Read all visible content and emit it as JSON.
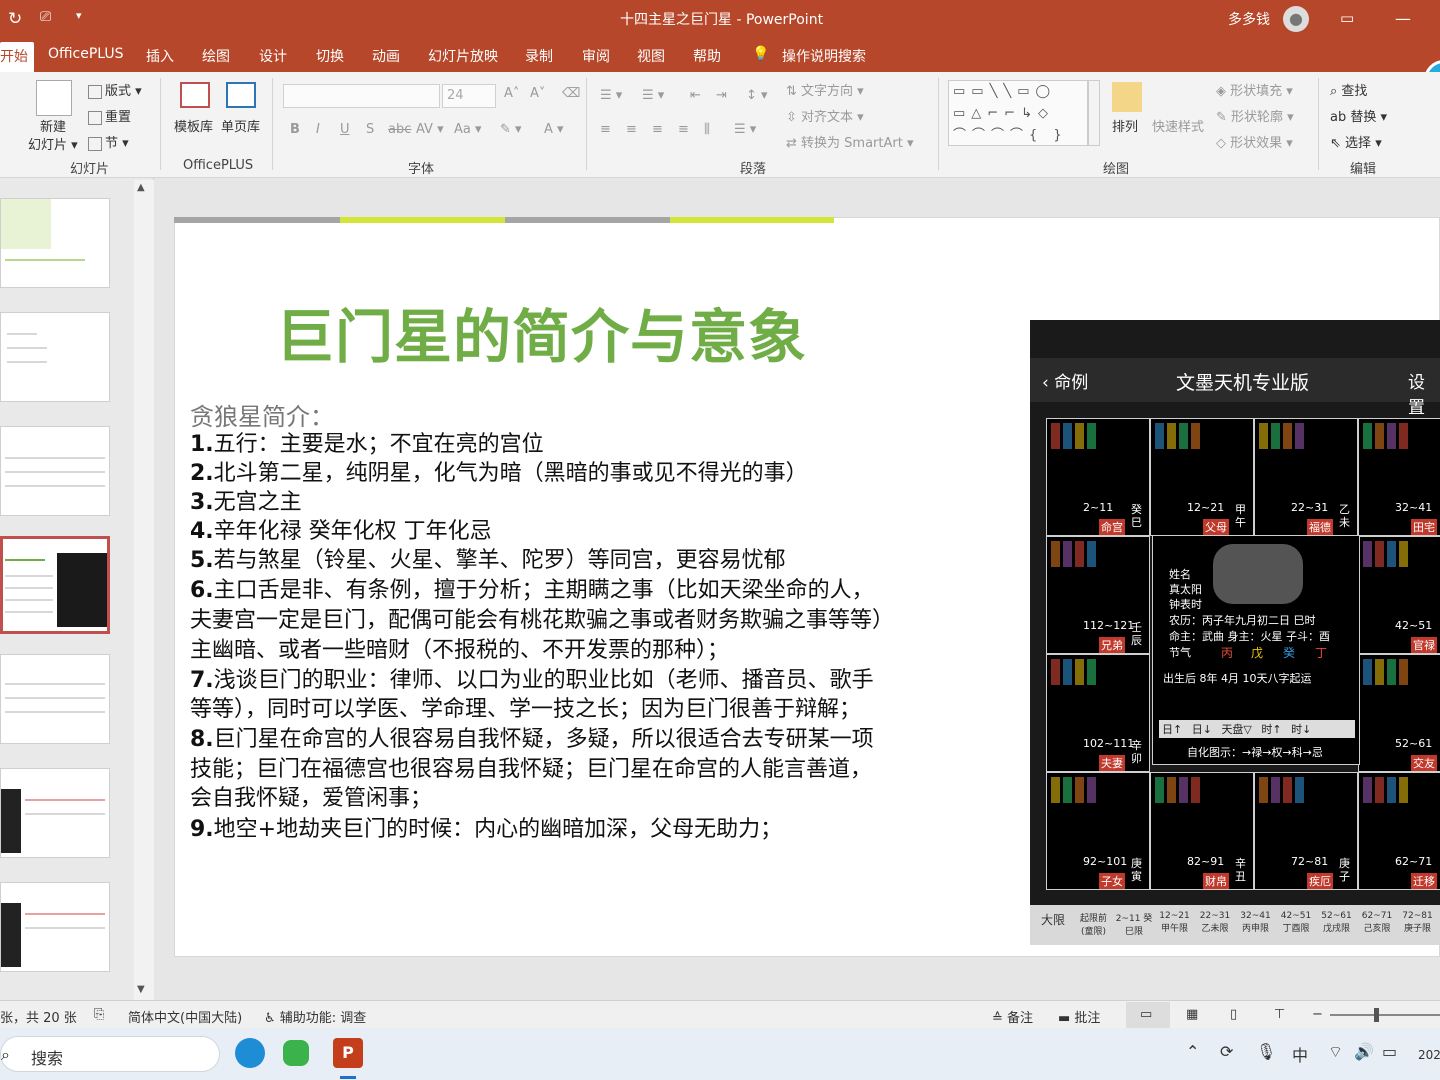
{
  "titlebar": {
    "doc_title": "十四主星之巨门星",
    "sep": "-",
    "app": "PowerPoint",
    "user": "多多钱"
  },
  "menu": [
    "开始",
    "OfficePLUS",
    "插入",
    "绘图",
    "设计",
    "切换",
    "动画",
    "幻灯片放映",
    "录制",
    "审阅",
    "视图",
    "帮助"
  ],
  "search_hint": "操作说明搜索",
  "ribbon": {
    "new_slide": "新建\n幻灯片",
    "layout": "版式",
    "reset": "重置",
    "section": "节",
    "template": "模板库",
    "single_page": "单页库",
    "font_size": "24",
    "text_direction": "文字方向",
    "align_text": "对齐文本",
    "smartart": "转换为 SmartArt",
    "arrange": "排列",
    "quick_styles": "快速样式",
    "shape_fill": "形状填充",
    "shape_outline": "形状轮廓",
    "shape_effects": "形状效果",
    "find": "查找",
    "replace": "替换",
    "select": "选择",
    "groups": {
      "slides": "幻灯片",
      "officeplus": "OfficePLUS",
      "font": "字体",
      "paragraph": "段落",
      "drawing": "绘图",
      "editing": "编辑"
    }
  },
  "slide": {
    "title": "巨门星的简介与意象",
    "subtitle": "贪狼星简介：",
    "lines": [
      {
        "num": "1.",
        "text": "五行：主要是水；不宜在亮的宫位"
      },
      {
        "num": "2.",
        "text": "北斗第二星，纯阴星，化气为暗（黑暗的事或见不得光的事）"
      },
      {
        "num": "3.",
        "text": "无宫之主"
      },
      {
        "num": "4.",
        "text": "辛年化禄 癸年化权  丁年化忌"
      },
      {
        "num": "5.",
        "text": "若与煞星（铃星、火星、擎羊、陀罗）等同宫，更容易忧郁"
      },
      {
        "num": "6.",
        "text": "主口舌是非、有条例，擅于分析；主期瞒之事（比如天梁坐命的人，"
      },
      {
        "num": "",
        "text": "夫妻宫一定是巨门，配偶可能会有桃花欺骗之事或者财务欺骗之事等等）"
      },
      {
        "num": "",
        "text": "主幽暗、或者一些暗财（不报税的、不开发票的那种）；"
      },
      {
        "num": "7.",
        "text": "浅谈巨门的职业：律师、以口为业的职业比如（老师、播音员、歌手"
      },
      {
        "num": "",
        "text": "等等），同时可以学医、学命理、学一技之长；因为巨门很善于辩解；"
      },
      {
        "num": "8.",
        "text": "巨门星在命宫的人很容易自我怀疑，多疑，所以很适合去专研某一项"
      },
      {
        "num": "",
        "text": "技能；巨门在福德宫也很容易自我怀疑；巨门星在命宫的人能言善道，"
      },
      {
        "num": "",
        "text": "会自我怀疑，爱管闲事；"
      },
      {
        "num": "9.",
        "text": "地空+地劫夹巨门的时候：内心的幽暗加深，父母无助力；"
      }
    ]
  },
  "chart_image": {
    "back": "命例",
    "app_title": "文墨天机专业版",
    "settings": "设置",
    "palaces": [
      {
        "name": "命宫",
        "age": "2~11",
        "branch": "癸巳"
      },
      {
        "name": "父母",
        "age": "12~21",
        "branch": "甲午"
      },
      {
        "name": "福德",
        "age": "22~31",
        "branch": "乙未"
      },
      {
        "name": "田宅",
        "age": "32~41",
        "branch": "丙申"
      },
      {
        "name": "兄弟",
        "age": "112~121",
        "branch": "壬辰"
      },
      {
        "name": "官禄",
        "age": "42~51",
        "branch": "丁酉"
      },
      {
        "name": "夫妻",
        "age": "102~111",
        "branch": "辛卯"
      },
      {
        "name": "交友",
        "age": "52~61",
        "branch": "戊戌"
      },
      {
        "name": "子女",
        "age": "92~101",
        "branch": "庚寅"
      },
      {
        "name": "财帛",
        "age": "82~91",
        "branch": "辛丑"
      },
      {
        "name": "疾厄",
        "age": "72~81",
        "branch": "庚子"
      },
      {
        "name": "迁移",
        "age": "62~71",
        "branch": "己亥"
      }
    ],
    "center": {
      "label1": "姓名",
      "label2": "真太阳",
      "label3": "钟表时",
      "lunar": "农历：丙子年九月初二日 巳时",
      "master": "命主：武曲 身主：火星 子斗：酉",
      "jieqi": "节气",
      "pillars": [
        "丙",
        "戊",
        "癸",
        "丁"
      ],
      "luck": "出生后 8年 4月 10天八字起运",
      "buttons": [
        "日↑",
        "日↓",
        "天盘▽",
        "时↑",
        "时↓"
      ],
      "legend": "自化图示：→禄→权→科→忌"
    },
    "bottom": [
      "大限",
      "起限前(童限)",
      "2~11 癸巳限",
      "12~21 甲午限",
      "22~31 乙未限",
      "32~41 丙申限",
      "42~51 丁酉限",
      "52~61 戊戌限",
      "62~71 己亥限",
      "72~81 庚子限"
    ]
  },
  "status": {
    "slide_count": "张，共 20 张",
    "language": "简体中文(中国大陆)",
    "accessibility": "辅助功能: 调查",
    "notes": "备注",
    "comments": "批注"
  },
  "taskbar": {
    "search": "搜索",
    "ime": "中",
    "year": "202"
  }
}
